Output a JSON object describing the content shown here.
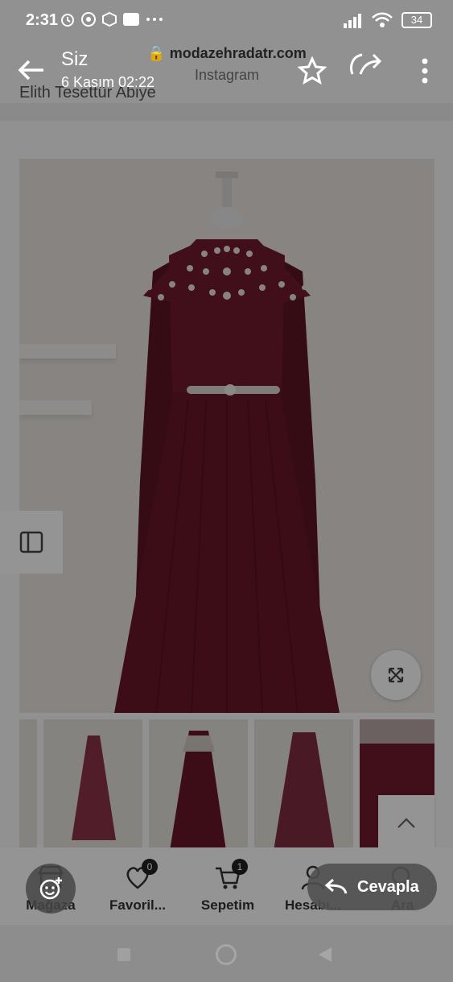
{
  "status_bar": {
    "time": "2:31",
    "battery": "34"
  },
  "story": {
    "user": "Siz",
    "date": "6 Kasım 02:22",
    "url": "modazehradatr.com",
    "source": "Instagram"
  },
  "page": {
    "title_peek": "Elith Tesettür Abiye"
  },
  "bottom_nav": {
    "items": [
      {
        "label": "Mağaza",
        "icon": "store-icon",
        "badge": ""
      },
      {
        "label": "Favoril...",
        "icon": "heart-icon",
        "badge": "0"
      },
      {
        "label": "Sepetim",
        "icon": "cart-icon",
        "badge": "1"
      },
      {
        "label": "Hesabı...",
        "icon": "user-icon",
        "badge": ""
      },
      {
        "label": "Ara",
        "icon": "search-icon",
        "badge": ""
      }
    ]
  },
  "reply": {
    "label": "Cevapla"
  },
  "colors": {
    "dress": "#6e1a2c",
    "dim_overlay": "#000000"
  }
}
